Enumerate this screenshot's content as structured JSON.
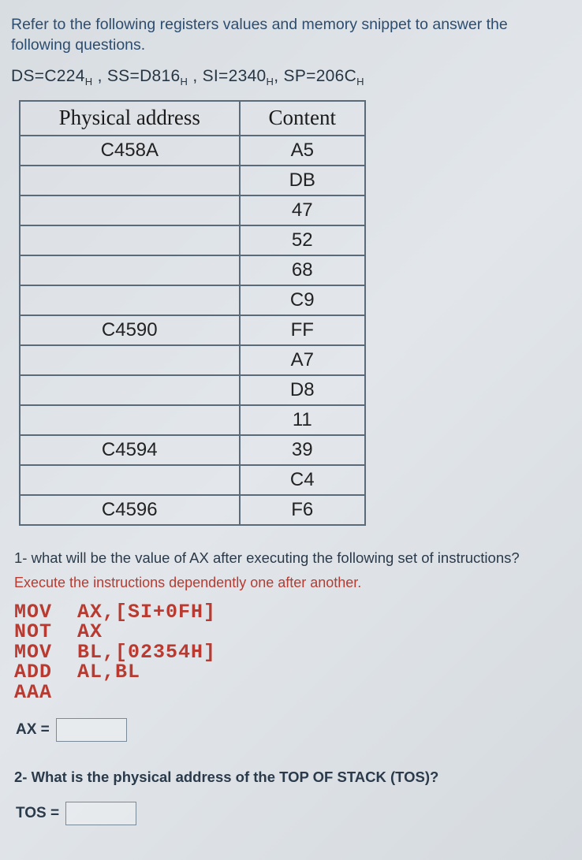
{
  "intro": "Refer to the following registers values and memory snippet to answer the following questions.",
  "registers": {
    "ds": {
      "label": "DS=",
      "value": "C224",
      "sub": "H"
    },
    "ss": {
      "label": "SS=",
      "value": "D816",
      "sub": "H"
    },
    "si": {
      "label": "SI=",
      "value": "2340",
      "sub": "H"
    },
    "sp": {
      "label": "SP=",
      "value": "206C",
      "sub": "H"
    }
  },
  "table": {
    "headers": {
      "addr": "Physical address",
      "content": "Content"
    },
    "rows": [
      {
        "addr": "C458A",
        "content": "A5"
      },
      {
        "addr": "",
        "content": "DB"
      },
      {
        "addr": "",
        "content": "47"
      },
      {
        "addr": "",
        "content": "52"
      },
      {
        "addr": "",
        "content": "68"
      },
      {
        "addr": "",
        "content": "C9"
      },
      {
        "addr": "C4590",
        "content": "FF"
      },
      {
        "addr": "",
        "content": "A7"
      },
      {
        "addr": "",
        "content": "D8"
      },
      {
        "addr": "",
        "content": "11"
      },
      {
        "addr": "C4594",
        "content": "39"
      },
      {
        "addr": "",
        "content": "C4"
      },
      {
        "addr": "C4596",
        "content": "F6"
      }
    ]
  },
  "q1": "1- what will be the value of AX after executing the following set of instructions?",
  "execnote": "Execute the instructions dependently one after another.",
  "code": "MOV  AX,[SI+0FH]\nNOT  AX\nMOV  BL,[02354H]\nADD  AL,BL\nAAA",
  "answer1_label": "AX =",
  "q2": "2- What is the physical address of the TOP OF STACK (TOS)?",
  "answer2_label": "TOS ="
}
